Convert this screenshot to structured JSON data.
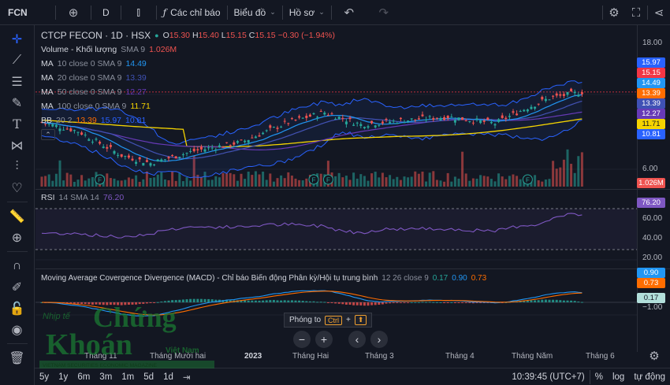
{
  "topbar": {
    "symbol": "FCN",
    "interval": "D",
    "indicators_label": "Các chỉ báo",
    "chart_type_label": "Biểu đồ",
    "profile_label": "Hồ sơ"
  },
  "legend": {
    "title": "CTCP FECON · 1D · HSX",
    "ohlc": {
      "o_label": "O",
      "o": "15.30",
      "h_label": "H",
      "h": "15.40",
      "l_label": "L",
      "l": "15.15",
      "c_label": "C",
      "c": "15.15",
      "change": "−0.30 (−1.94%)"
    },
    "volume": {
      "label": "Volume - Khối lượng",
      "params": "SMA 9",
      "value": "1.026M"
    },
    "ma10": {
      "label": "MA",
      "params": "10 close 0 SMA 9",
      "value": "14.49"
    },
    "ma20": {
      "label": "MA",
      "params": "20 close 0 SMA 9",
      "value": "13.39"
    },
    "ma50": {
      "label": "MA",
      "params": "50 close 0 SMA 9",
      "value": "12.27"
    },
    "ma100": {
      "label": "MA",
      "params": "100 close 0 SMA 9",
      "value": "11.71"
    },
    "bb": {
      "label": "BB",
      "params": "20 2",
      "v1": "13.39",
      "v2": "15.97",
      "v3": "10.81"
    },
    "rsi": {
      "label": "RSI",
      "params": "14 SMA 14",
      "value": "76.20"
    },
    "macd": {
      "label": "Moving Average Covergence Divergence (MACD) - Chỉ báo Biến động Phân kỳ/Hội tụ trung bình",
      "params": "12 26 close 9",
      "v1": "0.17",
      "v2": "0.90",
      "v3": "0.73"
    }
  },
  "price_axis": {
    "ticks": [
      "18.00",
      "6.00",
      "80.00",
      "60.00",
      "40.00",
      "20.00",
      "−1.00"
    ],
    "labels": [
      {
        "text": "15.97",
        "color": "#2962ff"
      },
      {
        "text": "15.15",
        "color": "#f23645"
      },
      {
        "text": "14.49",
        "color": "#2196f3"
      },
      {
        "text": "13.39",
        "color": "#ff6d00"
      },
      {
        "text": "13.39",
        "color": "#3f51b5"
      },
      {
        "text": "12.27",
        "color": "#673ab7"
      },
      {
        "text": "11.71",
        "color": "#f5d400"
      },
      {
        "text": "10.81",
        "color": "#2962ff"
      }
    ],
    "volume_label": "1.026M",
    "rsi_label": "76.20",
    "macd_labels": [
      "0.90",
      "0.73",
      "0.17"
    ]
  },
  "time_axis": [
    "Tháng 11",
    "Tháng Mười hai",
    "2023",
    "Tháng Hai",
    "Tháng 3",
    "Tháng 4",
    "Tháng Năm",
    "Tháng 6"
  ],
  "bottombar": {
    "ranges": [
      "5y",
      "1y",
      "6m",
      "3m",
      "1m",
      "5d",
      "1d"
    ],
    "time": "10:39:45 (UTC+7)",
    "percent": "%",
    "log": "log",
    "auto": "tự động"
  },
  "tooltip": {
    "label": "Phóng to",
    "key1": "Ctrl",
    "plus": "+",
    "key2": "⬆"
  },
  "watermark": {
    "line1": "Chứng",
    "line2": "Khoán",
    "small": "Việt Nam",
    "prefix": "Nhịp tế",
    "tagline": "VIETNAM SECURITIES ECONOMIC MAGAZINE"
  },
  "colors": {
    "up": "#26a69a",
    "down": "#ef5350",
    "bg": "#131722"
  }
}
